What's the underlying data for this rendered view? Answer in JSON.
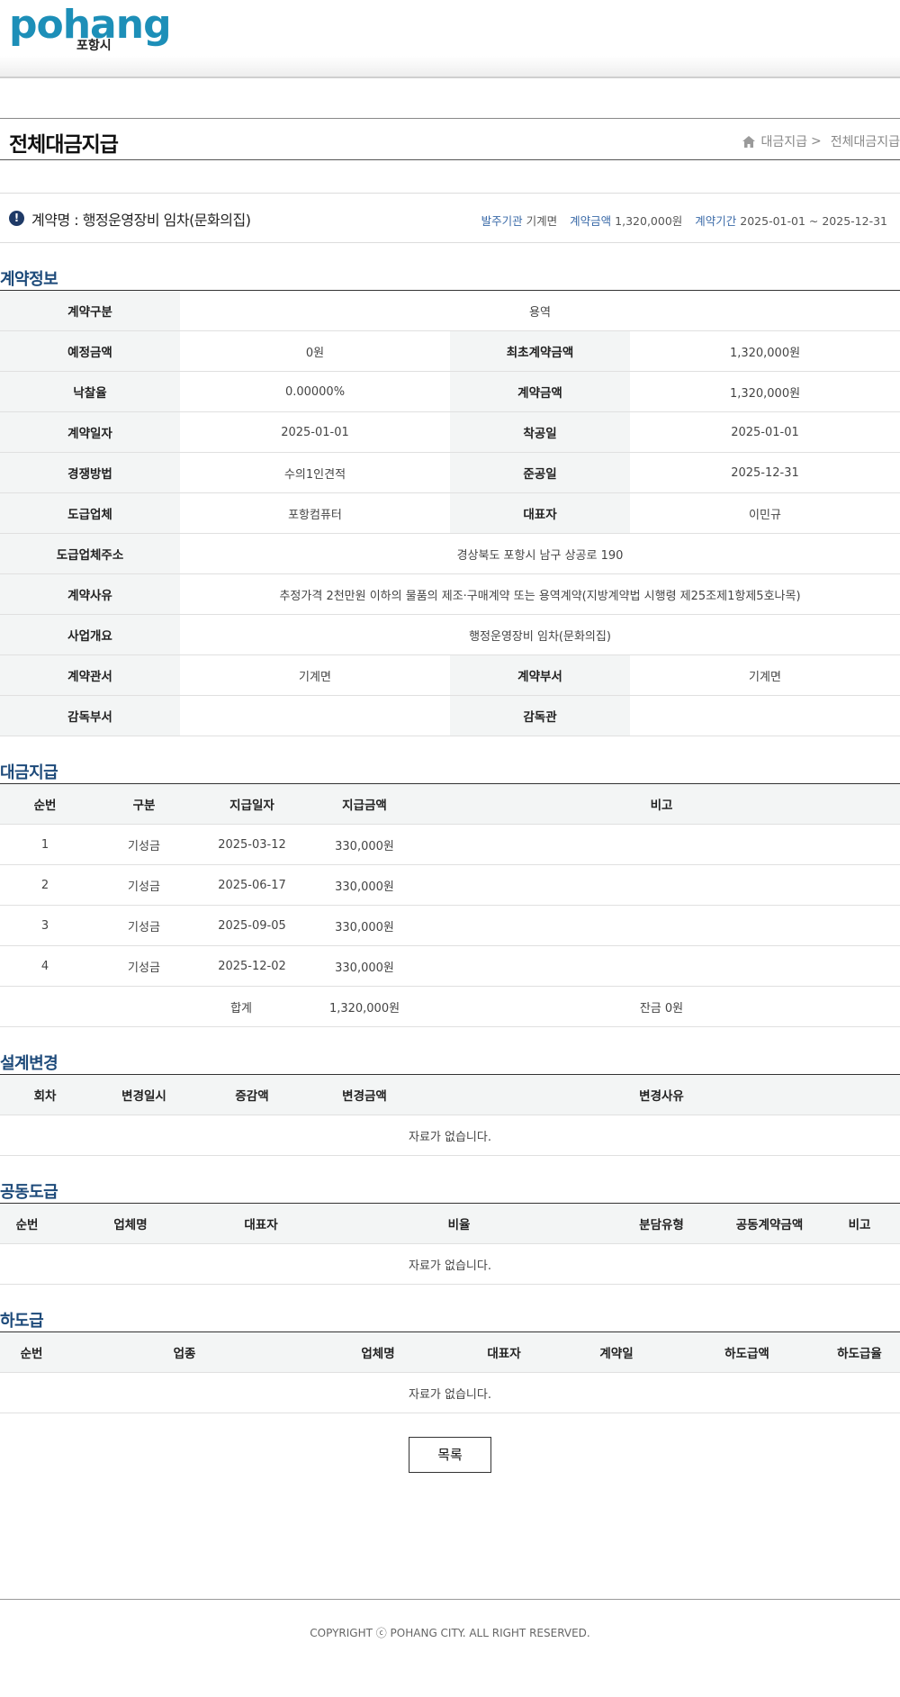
{
  "brand": {
    "logo_word": "pohang",
    "logo_sub": "포항시"
  },
  "page": {
    "title": "전체대금지급"
  },
  "breadcrumb": {
    "item1": "대금지급",
    "sep": ">",
    "item2": "전체대금지급"
  },
  "summary": {
    "contract_name": "계약명 : 행정운영장비 임차(문화의집)",
    "ordering_label": "발주기관",
    "ordering_value": "기계면",
    "amount_label": "계약금액",
    "amount_value": "1,320,000원",
    "period_label": "계약기간",
    "period_value": "2025-01-01 ~ 2025-12-31"
  },
  "contract_info": {
    "title": "계약정보",
    "type_label": "계약구분",
    "type_value": "용역",
    "est_label": "예정금액",
    "est_value": "0원",
    "initial_label": "최초계약금액",
    "initial_value": "1,320,000원",
    "rate_label": "낙찰율",
    "rate_value": "0.00000%",
    "amount_label": "계약금액",
    "amount_value": "1,320,000원",
    "date_label": "계약일자",
    "date_value": "2025-01-01",
    "start_label": "착공일",
    "start_value": "2025-01-01",
    "method_label": "경쟁방법",
    "method_value": "수의1인견적",
    "end_label": "준공일",
    "end_value": "2025-12-31",
    "vendor_label": "도급업체",
    "vendor_value": "포항컴퓨터",
    "ceo_label": "대표자",
    "ceo_value": "이민규",
    "address_label": "도급업체주소",
    "address_value": "경상북도 포항시 남구 상공로 190",
    "reason_label": "계약사유",
    "reason_value": "추정가격 2천만원 이하의 물품의 제조·구매계약 또는 용역계약(지방계약법 시행령 제25조제1항제5호나목)",
    "overview_label": "사업개요",
    "overview_value": "행정운영장비 임차(문화의집)",
    "office_label": "계약관서",
    "office_value": "기계면",
    "dept_label": "계약부서",
    "dept_value": "기계면",
    "sup_dept_label": "감독부서",
    "sup_dept_value": "",
    "supervisor_label": "감독관",
    "supervisor_value": ""
  },
  "payments": {
    "title": "대금지급",
    "headers": [
      "순번",
      "구분",
      "지급일자",
      "지급금액",
      "비고"
    ],
    "rows": [
      [
        "1",
        "기성금",
        "2025-03-12",
        "330,000원",
        ""
      ],
      [
        "2",
        "기성금",
        "2025-06-17",
        "330,000원",
        ""
      ],
      [
        "3",
        "기성금",
        "2025-09-05",
        "330,000원",
        ""
      ],
      [
        "4",
        "기성금",
        "2025-12-02",
        "330,000원",
        ""
      ]
    ],
    "total_label": "합계",
    "total_value": "1,320,000원",
    "balance": "잔금 0원"
  },
  "design_change": {
    "title": "설계변경",
    "headers": [
      "회차",
      "변경일시",
      "증감액",
      "변경금액",
      "변경사유"
    ],
    "empty": "자료가 없습니다."
  },
  "joint": {
    "title": "공동도급",
    "headers": [
      "순번",
      "업체명",
      "대표자",
      "비율",
      "분담유형",
      "공동계약금액",
      "비고"
    ],
    "empty": "자료가 없습니다."
  },
  "subcontract": {
    "title": "하도급",
    "headers": [
      "순번",
      "업종",
      "업체명",
      "대표자",
      "계약일",
      "하도급액",
      "하도급율"
    ],
    "empty": "자료가 없습니다."
  },
  "actions": {
    "list_label": "목록"
  },
  "footer": {
    "copyright": "COPYRIGHT ⓒ POHANG CITY. ALL RIGHT RESERVED."
  }
}
